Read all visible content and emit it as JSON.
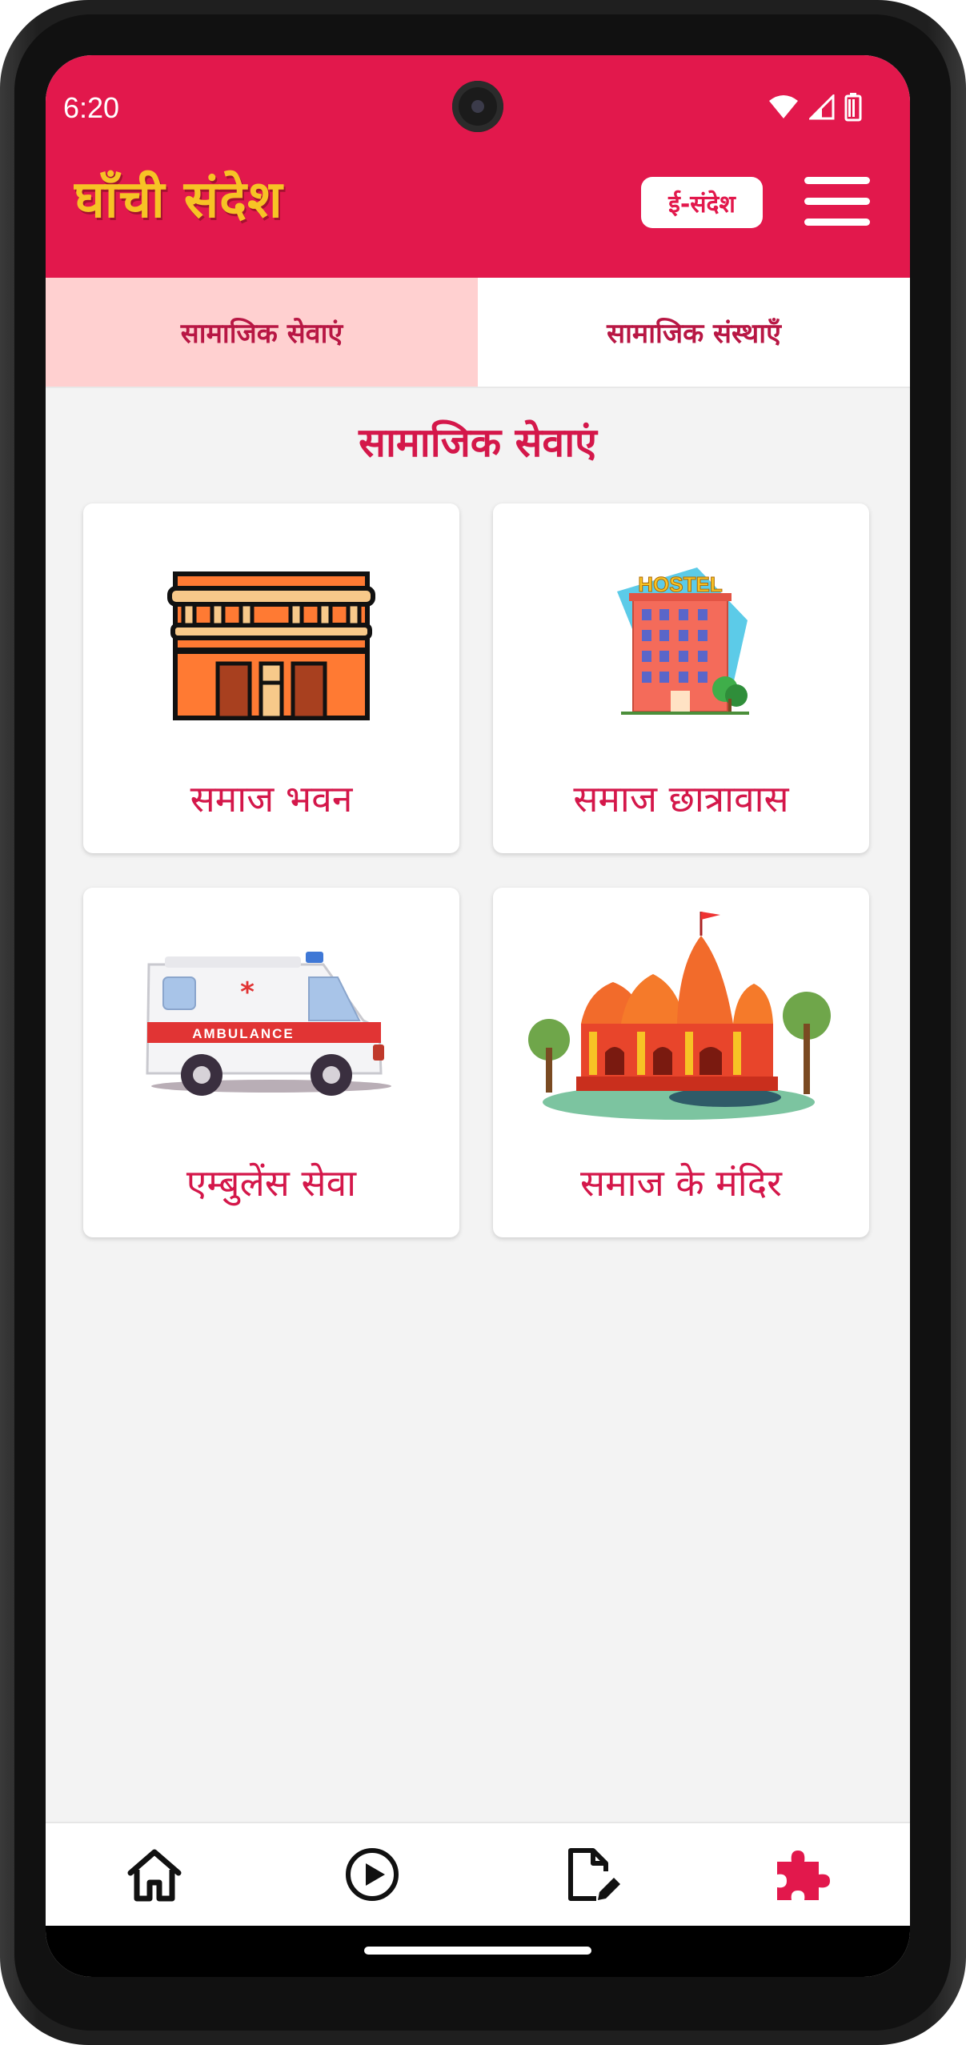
{
  "status_bar": {
    "time": "6:20"
  },
  "app_bar": {
    "logo_text": "घाँची संदेश",
    "esandesh_label": "ई-संदेश"
  },
  "tabs": [
    {
      "label": "सामाजिक सेवाएं",
      "active": true
    },
    {
      "label": "सामाजिक संस्थाएँ",
      "active": false
    }
  ],
  "section_title": "सामाजिक सेवाएं",
  "cards": [
    {
      "label": "समाज भवन",
      "icon": "building-icon"
    },
    {
      "label": "समाज छात्रावास",
      "icon": "hostel-icon"
    },
    {
      "label": "एम्बुलेंस सेवा",
      "icon": "ambulance-icon"
    },
    {
      "label": "समाज के मंदिर",
      "icon": "temple-icon"
    }
  ],
  "illustration_text": {
    "hostel_sign": "HOSTEL",
    "ambulance_text": "AMBULANCE"
  },
  "bottom_nav": [
    {
      "icon": "home-icon",
      "active": false
    },
    {
      "icon": "play-circle-icon",
      "active": false
    },
    {
      "icon": "edit-document-icon",
      "active": false
    },
    {
      "icon": "puzzle-icon",
      "active": true
    }
  ],
  "colors": {
    "primary": "#e2184c",
    "logo_yellow": "#f7c325",
    "active_tab_bg": "#ffd0d0",
    "text_accent": "#d4174a"
  }
}
